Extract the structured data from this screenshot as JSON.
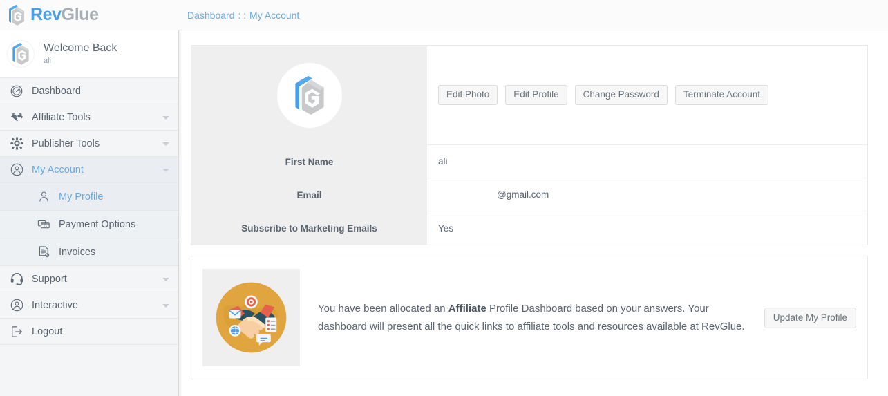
{
  "brand": {
    "name_part1": "Rev",
    "name_part2": "Glue",
    "logo_icon": "revglue-cube-logo"
  },
  "breadcrumb": {
    "root": "Dashboard",
    "separator": ": :",
    "current": "My Account"
  },
  "sidebar": {
    "welcome": {
      "title": "Welcome Back",
      "username": "ali",
      "avatar_icon": "revglue-cube-logo"
    },
    "items": [
      {
        "label": "Dashboard",
        "icon": "speedometer-icon",
        "caret": false,
        "active": false
      },
      {
        "label": "Affiliate Tools",
        "icon": "handshake-icon",
        "caret": true,
        "active": false
      },
      {
        "label": "Publisher Tools",
        "icon": "hub-nodes-icon",
        "caret": true,
        "active": false
      },
      {
        "label": "My Account",
        "icon": "user-circle-icon",
        "caret": true,
        "active": true
      }
    ],
    "subitems": [
      {
        "label": "My Profile",
        "icon": "user-icon",
        "active": true
      },
      {
        "label": "Payment Options",
        "icon": "credit-cards-icon",
        "active": false
      },
      {
        "label": "Invoices",
        "icon": "invoice-document-icon",
        "active": false
      }
    ],
    "items_bottom": [
      {
        "label": "Support",
        "icon": "headset-icon",
        "caret": true,
        "active": false
      },
      {
        "label": "Interactive",
        "icon": "user-circle-icon",
        "caret": true,
        "active": false
      },
      {
        "label": "Logout",
        "icon": "logout-arrow-icon",
        "caret": false,
        "active": false
      }
    ]
  },
  "profile": {
    "avatar_icon": "revglue-cube-logo",
    "actions": [
      {
        "label": "Edit Photo",
        "name": "edit-photo-button"
      },
      {
        "label": "Edit Profile",
        "name": "edit-profile-button"
      },
      {
        "label": "Change Password",
        "name": "change-password-button"
      },
      {
        "label": "Terminate Account",
        "name": "terminate-account-button"
      }
    ],
    "fields": [
      {
        "label": "First Name",
        "value": "ali"
      },
      {
        "label": "Email",
        "value": "@gmail.com"
      },
      {
        "label": "Subscribe to Marketing Emails",
        "value": "Yes"
      }
    ]
  },
  "dashboard_notice": {
    "illustration_icon": "handshake-partnership-illustration",
    "text_before": "You have been allocated an ",
    "text_bold": "Affiliate",
    "text_after": " Profile Dashboard based on your answers. Your dashboard will present all the quick links to affiliate tools and resources available at RevGlue.",
    "button_label": "Update My Profile"
  },
  "colors": {
    "brand_blue": "#4a9fe8",
    "brand_gray": "#a8aeb4",
    "link_blue": "#6aa9e0",
    "text": "#5a6470",
    "panel_gray": "#efefef",
    "sidebar_bg": "#f4f5f6",
    "illustration_orange": "#e0a53f",
    "illustration_teal": "#2a5262"
  }
}
